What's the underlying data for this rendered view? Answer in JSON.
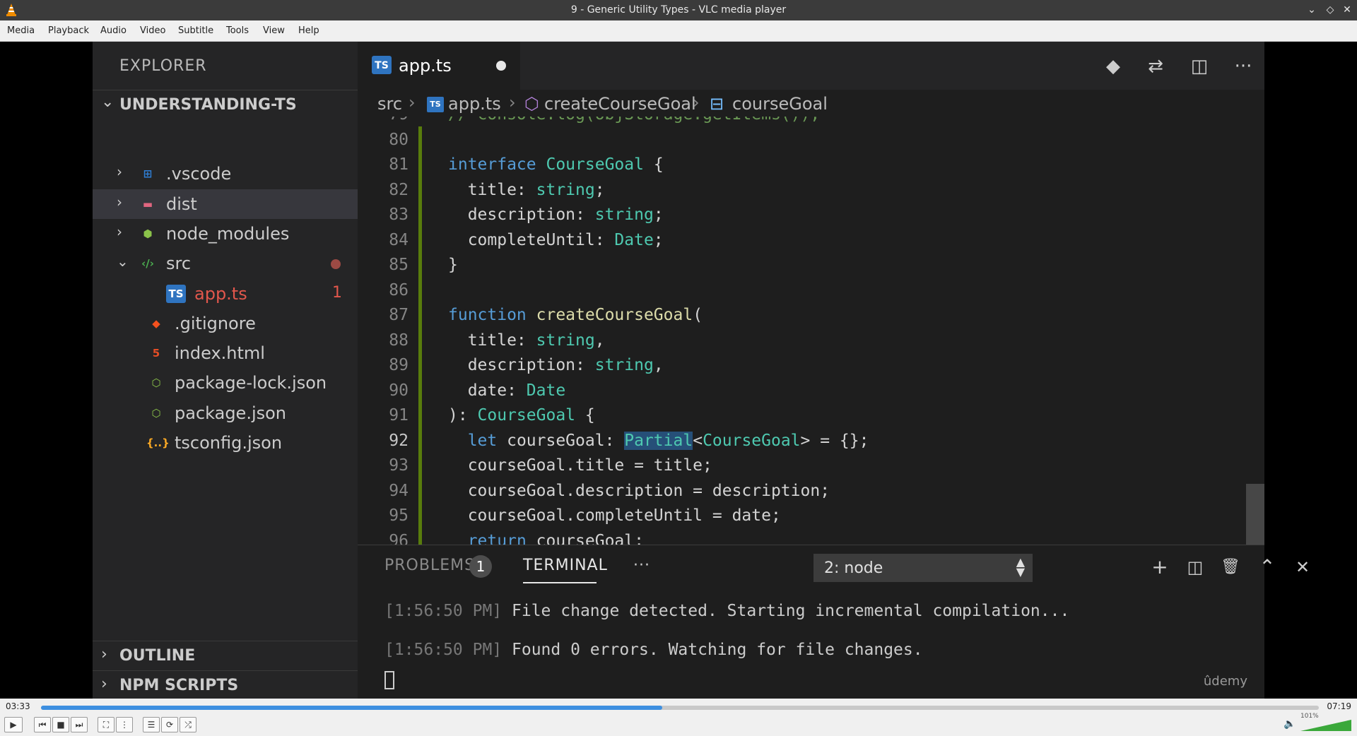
{
  "window": {
    "title": "9 - Generic Utility Types - VLC media player",
    "controls": [
      "minimize",
      "maximize",
      "close"
    ]
  },
  "menu": [
    "Media",
    "Playback",
    "Audio",
    "Video",
    "Subtitle",
    "Tools",
    "View",
    "Help"
  ],
  "sidebar": {
    "title": "EXPLORER",
    "project": "UNDERSTANDING-TS",
    "items": [
      {
        "label": ".vscode",
        "icon": "folder-vscode-icon",
        "color": "#2f7fd6",
        "badge": ""
      },
      {
        "label": "dist",
        "icon": "folder-dist-icon",
        "color": "#e06680",
        "badge": ""
      },
      {
        "label": "node_modules",
        "icon": "folder-node-icon",
        "color": "#8bc34a",
        "badge": ""
      },
      {
        "label": "src",
        "icon": "folder-src-icon",
        "color": "#4caf50",
        "badge": ""
      },
      {
        "label": "app.ts",
        "icon": "typescript-file-icon",
        "color": "#2f74c0",
        "badge": "1"
      },
      {
        "label": ".gitignore",
        "icon": "git-file-icon",
        "color": "#f4511e",
        "badge": ""
      },
      {
        "label": "index.html",
        "icon": "html-file-icon",
        "color": "#e44d26",
        "badge": ""
      },
      {
        "label": "package-lock.json",
        "icon": "nodejs-file-icon",
        "color": "#8bc34a",
        "badge": ""
      },
      {
        "label": "package.json",
        "icon": "nodejs-file-icon",
        "color": "#8bc34a",
        "badge": ""
      },
      {
        "label": "tsconfig.json",
        "icon": "json-file-icon",
        "color": "#f9a825",
        "badge": ""
      }
    ],
    "outline": "OUTLINE",
    "npm_scripts": "NPM SCRIPTS"
  },
  "editor": {
    "tab_label": "app.ts",
    "tab_icon_text": "TS",
    "breadcrumb": [
      "src",
      "app.ts",
      "createCourseGoal",
      "courseGoal"
    ],
    "active_line": 92,
    "lines": [
      {
        "n": "79",
        "text": "// console.log(objStorage.getItems());"
      },
      {
        "n": "80",
        "text": ""
      },
      {
        "n": "81",
        "text": "interface CourseGoal {"
      },
      {
        "n": "82",
        "text": "  title: string;"
      },
      {
        "n": "83",
        "text": "  description: string;"
      },
      {
        "n": "84",
        "text": "  completeUntil: Date;"
      },
      {
        "n": "85",
        "text": "}"
      },
      {
        "n": "86",
        "text": ""
      },
      {
        "n": "87",
        "text": "function createCourseGoal("
      },
      {
        "n": "88",
        "text": "  title: string,"
      },
      {
        "n": "89",
        "text": "  description: string,"
      },
      {
        "n": "90",
        "text": "  date: Date"
      },
      {
        "n": "91",
        "text": "): CourseGoal {"
      },
      {
        "n": "92",
        "text": "  let courseGoal: Partial<CourseGoal> = {};"
      },
      {
        "n": "93",
        "text": "  courseGoal.title = title;"
      },
      {
        "n": "94",
        "text": "  courseGoal.description = description;"
      },
      {
        "n": "95",
        "text": "  courseGoal.completeUntil = date;"
      },
      {
        "n": "96",
        "text": "  return courseGoal;"
      }
    ]
  },
  "panel": {
    "problems_label": "PROBLEMS",
    "problems_count": "1",
    "terminal_label": "TERMINAL",
    "more": "···",
    "terminal_select": "2: node",
    "terminal_lines": [
      {
        "time": "[1:56:50 PM]",
        "message": " File change detected. Starting incremental compilation..."
      },
      {
        "time": "[1:56:50 PM]",
        "message": " Found 0 errors. Watching for file changes."
      }
    ],
    "watermark": "ûdemy"
  },
  "player": {
    "elapsed": "03:33",
    "total": "07:19",
    "progress": 0.486,
    "volume_label": "101%",
    "volume": 1.01,
    "accent": "#3d8fe0"
  }
}
